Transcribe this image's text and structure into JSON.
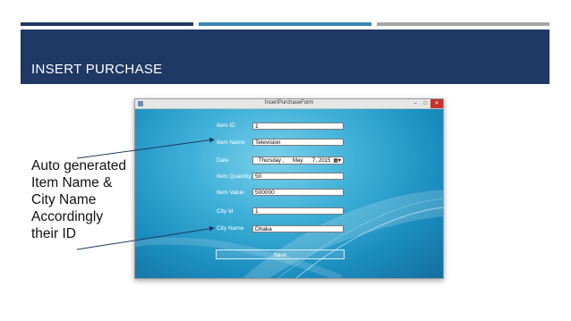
{
  "slide": {
    "title": "INSERT PURCHASE",
    "annotation": "Auto generated Item Name & City Name Accordingly their ID",
    "colors": {
      "header": "#1f3864",
      "accent_blue": "#3a86b4",
      "accent_gray": "#a6a6a6"
    }
  },
  "window": {
    "title": "InsertPurchaseForm",
    "minimize": "–",
    "maximize": "□",
    "close": "✕"
  },
  "form": {
    "item_id": {
      "label": "Item ID",
      "value": "1"
    },
    "item_name": {
      "label": "Item Name",
      "value": "Television"
    },
    "date": {
      "label": "Date",
      "day": "Thursday ,",
      "month": "May",
      "daynum": "7,",
      "year": "2015",
      "icon": "calendar-dropdown-icon"
    },
    "item_quantity": {
      "label": "Item Quantity",
      "value": "50"
    },
    "item_value": {
      "label": "Item Value",
      "value": "500000"
    },
    "city_id": {
      "label": "City Id",
      "value": "1"
    },
    "city_name": {
      "label": "City Name",
      "value": "Dhaka"
    },
    "save_label": "Save"
  }
}
